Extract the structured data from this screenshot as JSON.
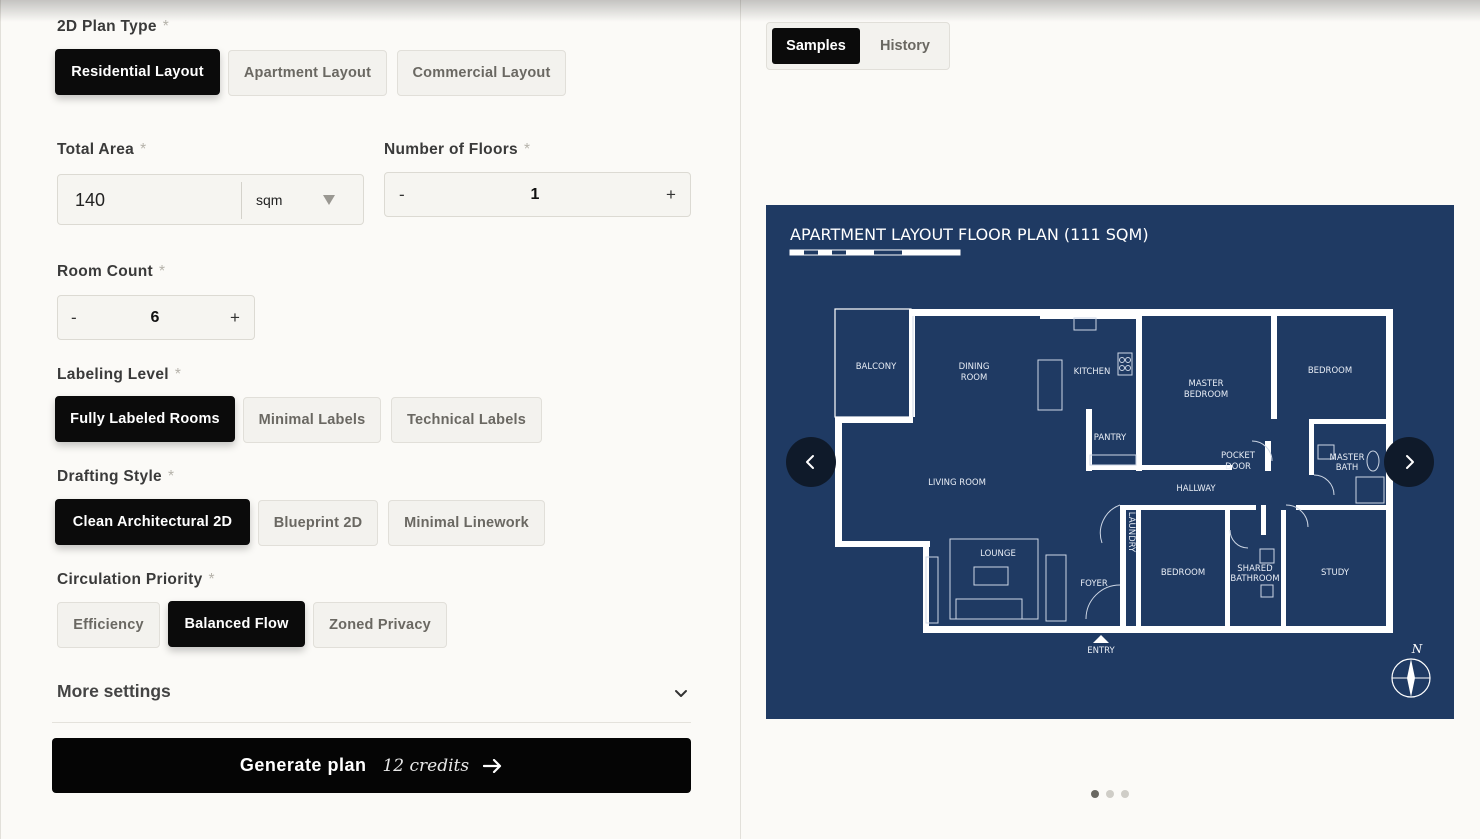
{
  "form": {
    "plan_type": {
      "label": "2D Plan Type",
      "required": "*",
      "options": [
        "Residential Layout",
        "Apartment Layout",
        "Commercial Layout"
      ],
      "selected": "Residential Layout"
    },
    "total_area": {
      "label": "Total Area",
      "required": "*",
      "value": "140",
      "unit": "sqm"
    },
    "floors": {
      "label": "Number of Floors",
      "required": "*",
      "minus": "-",
      "value": "1",
      "plus": "+"
    },
    "rooms": {
      "label": "Room Count",
      "required": "*",
      "minus": "-",
      "value": "6",
      "plus": "+"
    },
    "labeling": {
      "label": "Labeling Level",
      "required": "*",
      "options": [
        "Fully Labeled Rooms",
        "Minimal Labels",
        "Technical Labels"
      ],
      "selected": "Fully Labeled Rooms"
    },
    "drafting": {
      "label": "Drafting Style",
      "required": "*",
      "options": [
        "Clean Architectural 2D",
        "Blueprint 2D",
        "Minimal Linework"
      ],
      "selected": "Clean Architectural 2D"
    },
    "circulation": {
      "label": "Circulation Priority",
      "required": "*",
      "options": [
        "Efficiency",
        "Balanced Flow",
        "Zoned Privacy"
      ],
      "selected": "Balanced Flow"
    },
    "more_settings": "More settings",
    "generate": {
      "label": "Generate plan",
      "credits": "12 credits"
    }
  },
  "preview": {
    "tabs": [
      "Samples",
      "History"
    ],
    "active_tab": "Samples",
    "plan": {
      "title": "APARTMENT LAYOUT FLOOR PLAN (111 SQM)",
      "rooms": {
        "balcony": "BALCONY",
        "dining1": "DINING",
        "dining2": "ROOM",
        "kitchen": "KITCHEN",
        "master1": "MASTER",
        "master2": "BEDROOM",
        "bedroom_ne": "BEDROOM",
        "pantry": "PANTRY",
        "pocket1": "POCKET",
        "pocket2": "DOOR",
        "mbath1": "MASTER",
        "mbath2": "BATH",
        "living": "LIVING ROOM",
        "hallway": "HALLWAY",
        "laundry": "LAUNDRY",
        "lounge": "LOUNGE",
        "foyer": "FOYER",
        "bedroom_s": "BEDROOM",
        "shared1": "SHARED",
        "shared2": "BATHROOM",
        "study": "STUDY",
        "entry": "ENTRY",
        "north": "N"
      }
    },
    "carousel": {
      "count": 3,
      "active": 1
    }
  },
  "colors": {
    "accent": "#0b0b0b",
    "plan_background": "#1f3a63",
    "page_background": "#fbfaf7"
  }
}
